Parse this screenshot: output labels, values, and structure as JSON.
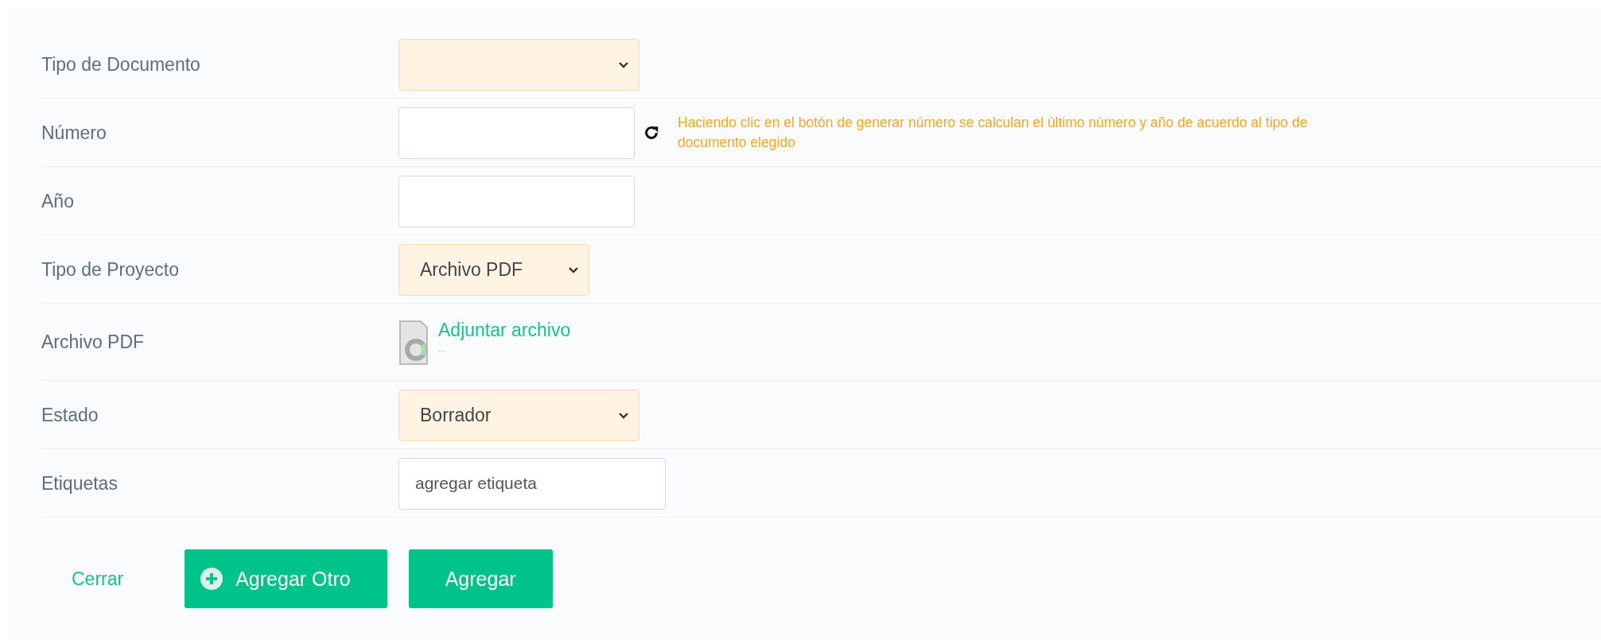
{
  "fields": [
    {
      "label": "Tipo de Documento",
      "kind": "select"
    },
    {
      "label": "Número",
      "kind": "input",
      "refresh": true,
      "hint": "Haciendo clic en el botón de generar número se calculan el último número y año de acuerdo al tipo de documento elegido"
    },
    {
      "label": "Año",
      "kind": "input"
    },
    {
      "label": "Tipo de Proyecto",
      "kind": "select",
      "value": "Archivo PDF"
    },
    {
      "label": "Archivo PDF",
      "kind": "file",
      "link": "Adjuntar archivo",
      "filename": "..."
    },
    {
      "label": "Estado",
      "kind": "select",
      "value": "Borrador"
    },
    {
      "label": "Etiquetas",
      "kind": "tags",
      "placeholder": "agregar etiqueta"
    }
  ],
  "actions": {
    "close": "Cerrar",
    "add_another": "Agregar Otro",
    "add": "Agregar"
  }
}
